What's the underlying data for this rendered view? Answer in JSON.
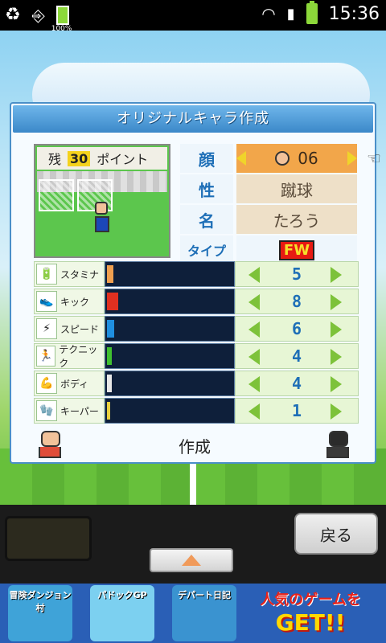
{
  "status_bar": {
    "time": "15:36",
    "battery_small_label": "100%",
    "icons": [
      "recycle-icon",
      "usb-icon",
      "battery-icon",
      "wifi-icon",
      "signal-icon",
      "battery-icon"
    ]
  },
  "dialog": {
    "title": "オリジナルキャラ作成",
    "points_label_left": "残",
    "points_value": "30",
    "points_label_right": "ポイント",
    "info": {
      "face_label": "顔",
      "face_value": "06",
      "sex_label": "性",
      "sex_value": "蹴球",
      "name_label": "名",
      "name_value": "たろう",
      "type_label": "タイプ",
      "type_value": "FW"
    },
    "stats": [
      {
        "label": "スタミナ",
        "value": "5",
        "fill_color": "#f0a050",
        "level": 0.05
      },
      {
        "label": "キック",
        "value": "8",
        "fill_color": "#e03020",
        "level": 0.09
      },
      {
        "label": "スピード",
        "value": "6",
        "fill_color": "#1f8fe0",
        "level": 0.06
      },
      {
        "label": "テクニック",
        "value": "4",
        "fill_color": "#40c030",
        "level": 0.04
      },
      {
        "label": "ボディ",
        "value": "4",
        "fill_color": "#e8e8e8",
        "level": 0.04
      },
      {
        "label": "キーパー",
        "value": "1",
        "fill_color": "#e8d040",
        "level": 0.01
      }
    ],
    "create_label": "作成"
  },
  "panel": {
    "back_label": "戻る"
  },
  "ad": {
    "thumbs": [
      "冒険ダンジョン村",
      "パドックGP",
      "デパート日記"
    ],
    "copy_line1": "人気のゲームを",
    "copy_line2": "GET!!"
  },
  "colors": {
    "dialog_header": "#3b88c9",
    "accent_blue": "#1e6fb7",
    "bar_bg": "#0e1f3a",
    "arrow_green": "#7dc23a"
  }
}
